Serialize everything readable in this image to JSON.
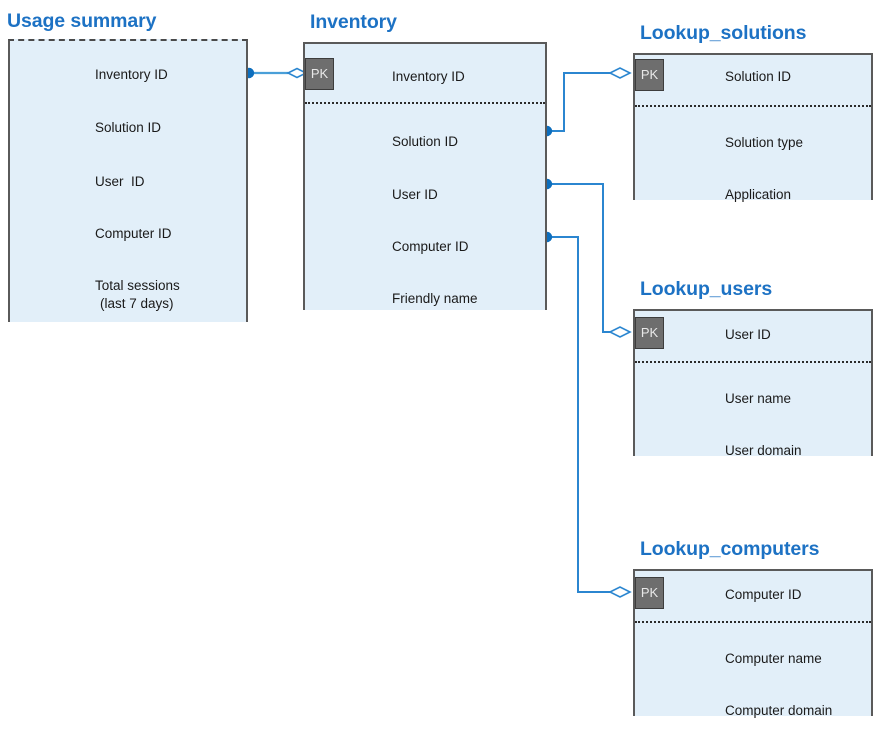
{
  "diagram": {
    "title_color": "#1d72c4",
    "entity_fill": "#e2eff9",
    "entity_border": "#5a5a5a",
    "connector_color": "#2b86d0",
    "pk_badge_fill": "#6e6e6e",
    "pk_badge_label": "PK"
  },
  "entities": {
    "usage_summary": {
      "title": "Usage summary",
      "fields": [
        {
          "label": "Inventory ID"
        },
        {
          "label": "Solution ID"
        },
        {
          "label": "User  ID"
        },
        {
          "label": "Computer ID"
        },
        {
          "label": "Total sessions",
          "label2": "(last 7 days)"
        }
      ]
    },
    "inventory": {
      "title": "Inventory",
      "pk_field": "Inventory ID",
      "fields": [
        {
          "label": "Inventory ID",
          "key": "PK"
        },
        {
          "label": "Solution ID"
        },
        {
          "label": "User ID"
        },
        {
          "label": "Computer ID"
        },
        {
          "label": "Friendly name"
        }
      ]
    },
    "lookup_solutions": {
      "title": "Lookup_solutions",
      "pk_field": "Solution ID",
      "fields": [
        {
          "label": "Solution ID",
          "key": "PK"
        },
        {
          "label": "Solution type"
        },
        {
          "label": "Application"
        }
      ]
    },
    "lookup_users": {
      "title": "Lookup_users",
      "pk_field": "User ID",
      "fields": [
        {
          "label": "User ID",
          "key": "PK"
        },
        {
          "label": "User name"
        },
        {
          "label": "User domain"
        }
      ]
    },
    "lookup_computers": {
      "title": "Lookup_computers",
      "pk_field": "Computer ID",
      "fields": [
        {
          "label": "Computer ID",
          "key": "PK"
        },
        {
          "label": "Computer name"
        },
        {
          "label": "Computer domain"
        }
      ]
    }
  },
  "relationships": [
    {
      "from": "usage_summary.Inventory ID",
      "to": "inventory.Inventory ID"
    },
    {
      "from": "inventory.Solution ID",
      "to": "lookup_solutions.Solution ID"
    },
    {
      "from": "inventory.User ID",
      "to": "lookup_users.User ID"
    },
    {
      "from": "inventory.Computer ID",
      "to": "lookup_computers.Computer ID"
    }
  ]
}
